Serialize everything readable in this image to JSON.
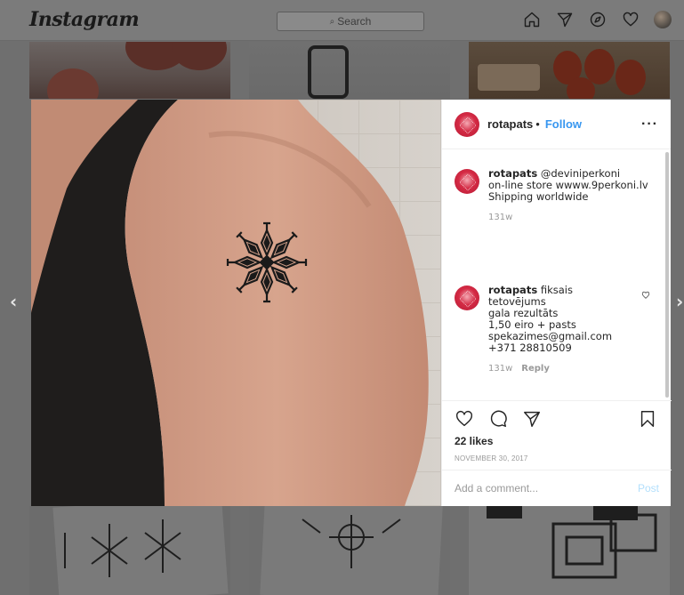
{
  "app": {
    "logo": "Instagram"
  },
  "search": {
    "placeholder": "Search",
    "glyph": "⌕"
  },
  "nav_icons": [
    "home-icon",
    "direct-icon",
    "explore-icon",
    "activity-heart-icon",
    "profile-avatar"
  ],
  "navigation": {
    "prev": "‹",
    "next": "›"
  },
  "post": {
    "username": "rotapats",
    "separator": "•",
    "follow_label": "Follow",
    "more_label": "···",
    "comments": [
      {
        "username": "rotapats",
        "lines": [
          "@deviniperkoni",
          "on-line store wwww.9perkoni.lv",
          "Shipping worldwide"
        ],
        "time": "131w",
        "reply_label": ""
      },
      {
        "username": "rotapats",
        "lines": [
          "fiksais",
          "tetovējums",
          "gala rezultāts",
          "1,50 eiro + pasts",
          "spekazimes@gmail.com",
          "+371 28810509"
        ],
        "time": "131w",
        "reply_label": "Reply"
      }
    ],
    "likes": "22 likes",
    "date": "NOVEMBER 30, 2017",
    "comment_placeholder": "Add a comment...",
    "post_label": "Post"
  },
  "colors": {
    "follow": "#3897f0",
    "post_disabled": "#b2dffc",
    "meta_grey": "#999999",
    "avatar_red": "#d42a44"
  }
}
